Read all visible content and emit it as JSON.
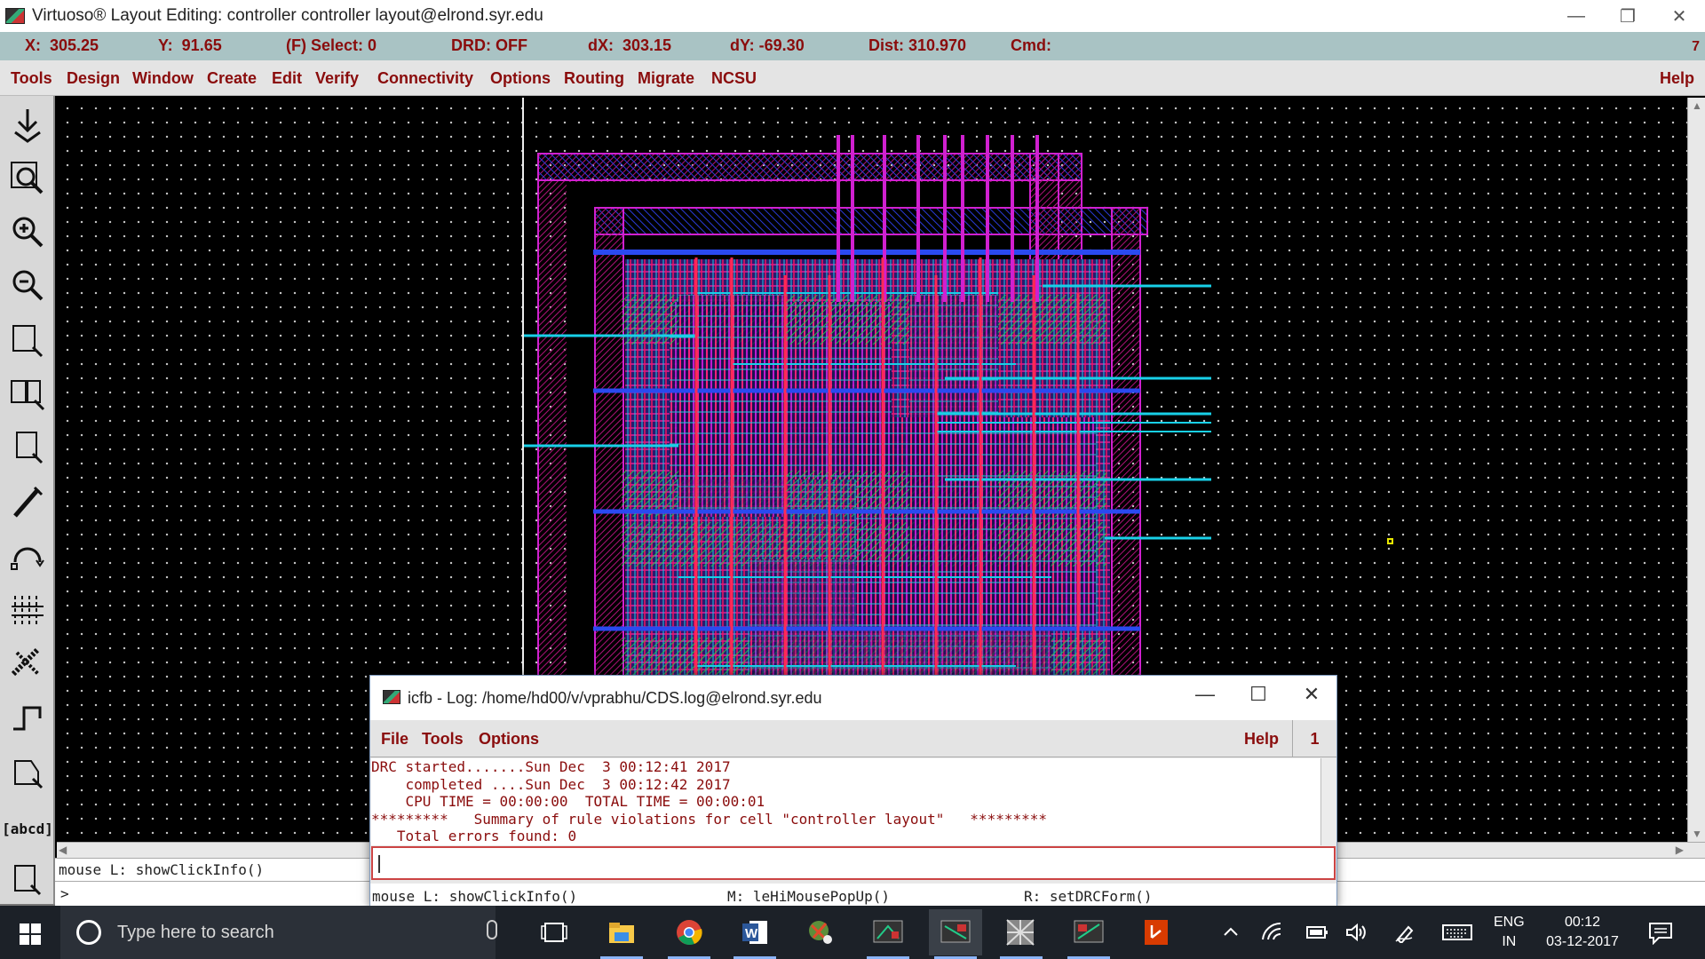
{
  "window": {
    "title": "Virtuoso® Layout Editing: controller controller layout@elrond.syr.edu",
    "minimize": "—",
    "restore": "❐",
    "close": "✕"
  },
  "status": {
    "x": "X:  305.25",
    "y": "Y:  91.65",
    "select": "(F) Select: 0",
    "drd": "DRD: OFF",
    "dx": "dX:  303.15",
    "dy": "dY: -69.30",
    "dist": "Dist: 310.970",
    "cmd": "Cmd:",
    "num": "7"
  },
  "menu": {
    "items": [
      "Tools",
      "Design",
      "Window",
      "Create",
      "Edit",
      "Verify",
      "Connectivity",
      "Options",
      "Routing",
      "Migrate",
      "NCSU"
    ],
    "help": "Help"
  },
  "tools": {
    "text_tool": "[abcd]"
  },
  "bottom": {
    "mouse": "mouse L: showClickInfo()",
    "prompt": ">"
  },
  "log": {
    "title": "icfb - Log: /home/hd00/v/vprabhu/CDS.log@elrond.syr.edu",
    "menu": [
      "File",
      "Tools",
      "Options"
    ],
    "help": "Help",
    "num": "1",
    "lines": [
      "DRC started.......Sun Dec  3 00:12:41 2017",
      "    completed ....Sun Dec  3 00:12:42 2017",
      "    CPU TIME = 00:00:00  TOTAL TIME = 00:00:01",
      "*********   Summary of rule violations for cell \"controller layout\"   *********",
      "   Total errors found: 0"
    ],
    "status_l": "mouse L: showClickInfo()",
    "status_m": "M: leHiMousePopUp()",
    "status_r": "R: setDRCForm()"
  },
  "taskbar": {
    "search_placeholder": "Type here to search",
    "lang_top": "ENG",
    "lang_bottom": "IN",
    "time": "00:12",
    "date": "03-12-2017"
  }
}
